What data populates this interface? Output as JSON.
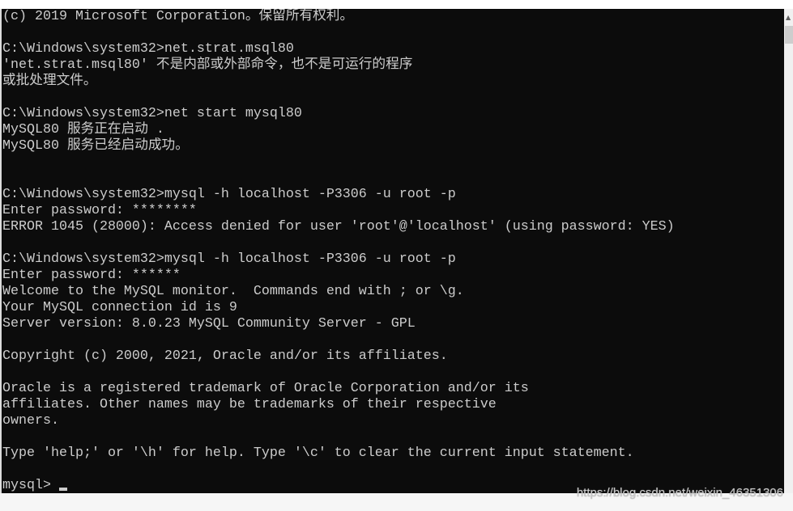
{
  "console": {
    "lines": [
      "(c) 2019 Microsoft Corporation。保留所有权利。",
      "",
      "C:\\Windows\\system32>net.strat.msql80",
      "'net.strat.msql80' 不是内部或外部命令，也不是可运行的程序",
      "或批处理文件。",
      "",
      "C:\\Windows\\system32>net start mysql80",
      "MySQL80 服务正在启动 .",
      "MySQL80 服务已经启动成功。",
      "",
      "",
      "C:\\Windows\\system32>mysql -h localhost -P3306 -u root -p",
      "Enter password: ********",
      "ERROR 1045 (28000): Access denied for user 'root'@'localhost' (using password: YES)",
      "",
      "C:\\Windows\\system32>mysql -h localhost -P3306 -u root -p",
      "Enter password: ******",
      "Welcome to the MySQL monitor.  Commands end with ; or \\g.",
      "Your MySQL connection id is 9",
      "Server version: 8.0.23 MySQL Community Server - GPL",
      "",
      "Copyright (c) 2000, 2021, Oracle and/or its affiliates.",
      "",
      "Oracle is a registered trademark of Oracle Corporation and/or its",
      "affiliates. Other names may be trademarks of their respective",
      "owners.",
      "",
      "Type 'help;' or '\\h' for help. Type '\\c' to clear the current input statement.",
      ""
    ],
    "prompt": "mysql>"
  },
  "watermark": "https://blog.csdn.net/weixin_46351306",
  "colors": {
    "background": "#0c0c0c",
    "text": "#cccccc"
  }
}
